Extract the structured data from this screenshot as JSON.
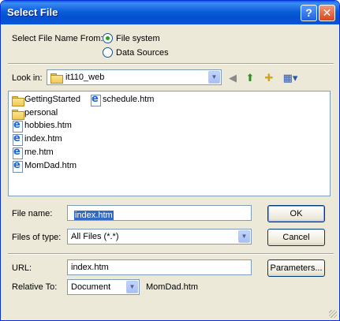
{
  "window": {
    "title": "Select File",
    "help_glyph": "?",
    "close_glyph": "✕"
  },
  "source": {
    "label": "Select File Name From:",
    "options": [
      "File system",
      "Data Sources"
    ],
    "selected": "File system"
  },
  "lookin": {
    "label": "Look in:",
    "value": "it110_web"
  },
  "toolbar_icons": [
    "back-icon",
    "up-folder-icon",
    "new-folder-icon",
    "view-menu-icon"
  ],
  "files": [
    {
      "name": "GettingStarted",
      "type": "folder"
    },
    {
      "name": "personal",
      "type": "folder"
    },
    {
      "name": "hobbies.htm",
      "type": "htm"
    },
    {
      "name": "index.htm",
      "type": "htm"
    },
    {
      "name": "me.htm",
      "type": "htm"
    },
    {
      "name": "MomDad.htm",
      "type": "htm"
    },
    {
      "name": "schedule.htm",
      "type": "htm"
    }
  ],
  "filename": {
    "label": "File name:",
    "value": "index.htm"
  },
  "filetype": {
    "label": "Files of type:",
    "value": "All Files (*.*)"
  },
  "url": {
    "label": "URL:",
    "value": "index.htm"
  },
  "relative": {
    "label": "Relative To:",
    "value": "Document",
    "file": "MomDad.htm"
  },
  "buttons": {
    "ok": "OK",
    "cancel": "Cancel",
    "parameters": "Parameters..."
  }
}
